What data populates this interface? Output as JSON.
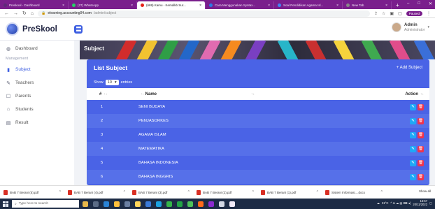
{
  "browser": {
    "tabs": [
      {
        "title": "Preskool - Dashboard",
        "favicon_color": "#5e2a78",
        "active": false
      },
      {
        "title": "(27) WhatsApp",
        "favicon_color": "#25d366",
        "active": false
      },
      {
        "title": "(669) Kamu - Kemdikb Sur...",
        "favicon_color": "#e62117",
        "active": true
      },
      {
        "title": "Cara Menggunakan Syntax...",
        "favicon_color": "#2c7be5",
        "active": false
      },
      {
        "title": "Soal Pendidikan Agama Isl...",
        "favicon_color": "#4285f4",
        "active": false
      },
      {
        "title": "New Tab",
        "favicon_color": "#888888",
        "active": false
      }
    ],
    "new_tab_glyph": "+",
    "window_controls": [
      "–",
      "□",
      "✕"
    ],
    "url_host": "elearning.accounting04.com",
    "url_path": "/admin/subject",
    "paused_label": "Paused"
  },
  "app": {
    "brand": "PreSkool",
    "user_name": "Admin",
    "user_role": "Administrator"
  },
  "sidebar": {
    "items": [
      {
        "label": "Dashboard",
        "icon": "gauge-icon",
        "glyph": "◍",
        "name": "sidebar-item-dashboard"
      },
      {
        "section": "Management"
      },
      {
        "label": "Subject",
        "icon": "book-icon",
        "glyph": "▮",
        "name": "sidebar-item-subject",
        "active": true
      },
      {
        "label": "Teachers",
        "icon": "teacher-icon",
        "glyph": "✎",
        "name": "sidebar-item-teachers"
      },
      {
        "label": "Parents",
        "icon": "parents-icon",
        "glyph": "☐",
        "name": "sidebar-item-parents"
      },
      {
        "label": "Students",
        "icon": "graduation-cap-icon",
        "glyph": "⌂",
        "name": "sidebar-item-students"
      },
      {
        "label": "Result",
        "icon": "result-icon",
        "glyph": "▤",
        "name": "sidebar-item-result"
      }
    ]
  },
  "page": {
    "hero_title": "Subject",
    "card_title": "List Subject",
    "add_label": "+ Add Subject",
    "show_label": "Show",
    "entries_value": "10",
    "entries_label": "entries",
    "columns": [
      "#",
      "Name",
      "",
      "Action"
    ]
  },
  "subjects": [
    {
      "no": "1",
      "name": "SENI BUDAYA"
    },
    {
      "no": "2",
      "name": "PENJASORKES"
    },
    {
      "no": "3",
      "name": "AGAMA ISLAM"
    },
    {
      "no": "4",
      "name": "MATEMATIKA"
    },
    {
      "no": "5",
      "name": "BAHASA INDONESIA"
    },
    {
      "no": "6",
      "name": "BAHASA INGGRIS"
    }
  ],
  "downloads": [
    "BAB 7 Berani (5).pdf",
    "BAB 7 Berani (4).pdf",
    "BAB 7 Berani (3).pdf",
    "BAB 7 Berani (2).pdf",
    "BAB 7 Berani (1).pdf",
    "Sistem Informasi....docx"
  ],
  "show_all_label": "Show all",
  "taskbar": {
    "search_placeholder": "Type here to search",
    "weather": "31°C",
    "time": "16:57",
    "date": "20/11/2022",
    "app_colors": [
      "#e8b84a",
      "#5a6b85",
      "#2a83d6",
      "#ffbf3c",
      "#6a7fa2",
      "#ffd55a",
      "#3b7bd8",
      "#1aa1e1",
      "#33b54a",
      "#22a447",
      "#4dc35b",
      "#ff6b1a",
      "#8b2bd0",
      "#d2d8e5",
      "#f0eaf8"
    ]
  }
}
